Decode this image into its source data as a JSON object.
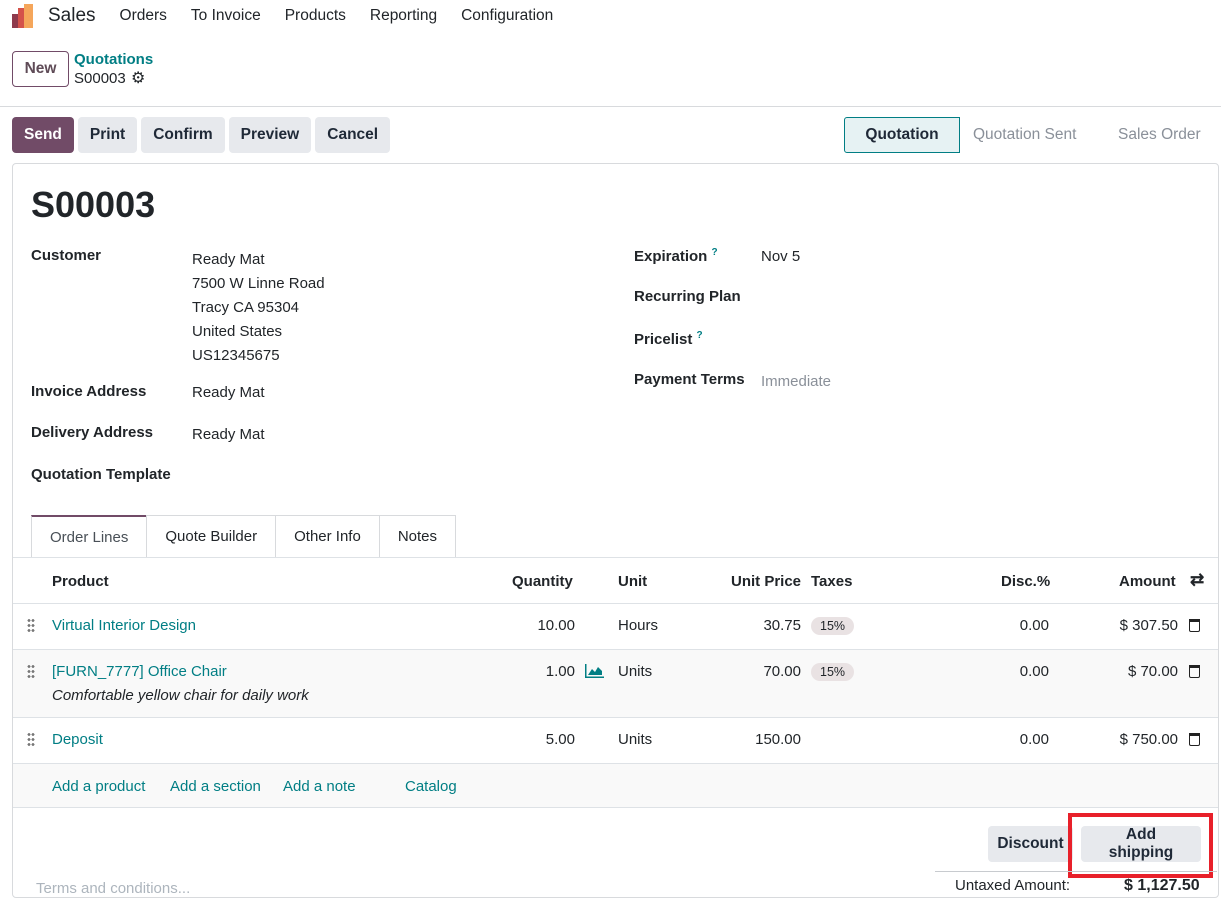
{
  "nav": {
    "app": "Sales",
    "menu": [
      "Orders",
      "To Invoice",
      "Products",
      "Reporting",
      "Configuration"
    ]
  },
  "control": {
    "new": "New",
    "breadcrumb": "Quotations",
    "record": "S00003"
  },
  "actions": {
    "send": "Send",
    "print": "Print",
    "confirm": "Confirm",
    "preview": "Preview",
    "cancel": "Cancel"
  },
  "stages": [
    "Quotation",
    "Quotation Sent",
    "Sales Order"
  ],
  "form": {
    "title": "S00003",
    "customer_label": "Customer",
    "customer": [
      "Ready Mat",
      "7500 W Linne Road",
      "Tracy CA 95304",
      "United States",
      "US12345675"
    ],
    "invoice_label": "Invoice Address",
    "invoice": "Ready Mat",
    "delivery_label": "Delivery Address",
    "delivery": "Ready Mat",
    "template_label": "Quotation Template",
    "expiration_label": "Expiration",
    "expiration": "Nov 5",
    "recurring_label": "Recurring Plan",
    "pricelist_label": "Pricelist",
    "terms_label": "Payment Terms",
    "terms": "Immediate",
    "help": "?"
  },
  "tabs": [
    "Order Lines",
    "Quote Builder",
    "Other Info",
    "Notes"
  ],
  "table": {
    "headers": {
      "product": "Product",
      "qty": "Quantity",
      "unit": "Unit",
      "price": "Unit Price",
      "taxes": "Taxes",
      "disc": "Disc.%",
      "amount": "Amount"
    },
    "rows": [
      {
        "product": "Virtual Interior Design",
        "desc": "",
        "qty": "10.00",
        "unit": "Hours",
        "price": "30.75",
        "tax": "15%",
        "disc": "0.00",
        "amount": "$ 307.50"
      },
      {
        "product": "[FURN_7777] Office Chair",
        "desc": "Comfortable yellow chair for daily work",
        "qty": "1.00",
        "unit": "Units",
        "price": "70.00",
        "tax": "15%",
        "disc": "0.00",
        "amount": "$ 70.00"
      },
      {
        "product": "Deposit",
        "desc": "",
        "qty": "5.00",
        "unit": "Units",
        "price": "150.00",
        "tax": "",
        "disc": "0.00",
        "amount": "$ 750.00"
      }
    ],
    "add_product": "Add a product",
    "add_section": "Add a section",
    "add_note": "Add a note",
    "catalog": "Catalog"
  },
  "footer": {
    "discount": "Discount",
    "shipping": "Add shipping",
    "terms_placeholder": "Terms and conditions...",
    "untaxed_label": "Untaxed Amount:",
    "untaxed": "$ 1,127.50"
  },
  "colors": {
    "primary": "#714b67",
    "link": "#017e84",
    "highlight": "#e8202a"
  }
}
